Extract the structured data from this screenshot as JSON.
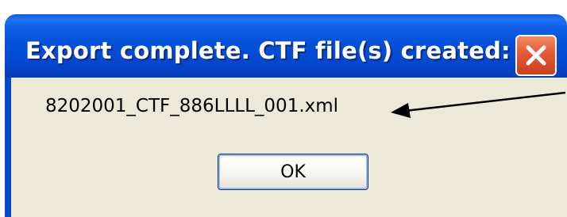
{
  "dialog": {
    "title": "Export complete.  CTF file(s) created:",
    "message": "8202001_CTF_886LLLL_001.xml",
    "ok_label": "OK"
  },
  "colors": {
    "title_bar": "#0450da",
    "client_background": "#ece9d8",
    "close_button": "#e35a35"
  },
  "icons": {
    "close": "close-icon",
    "annotation": "arrow-icon"
  }
}
